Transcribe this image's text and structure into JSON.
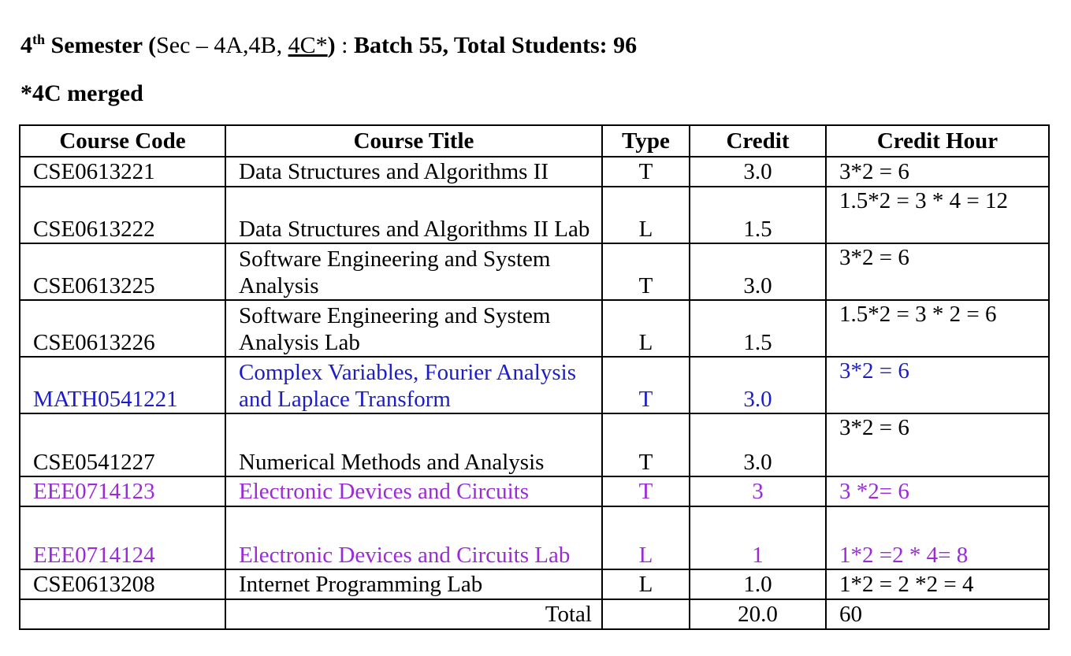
{
  "header": {
    "sem_num": "4",
    "sem_sup": "th",
    "sem_word": " Semester (",
    "sec_text": "Sec – 4A,4B, ",
    "sec_merged": "4C*",
    "close_paren": ")",
    "sep": " : ",
    "batch_text": "Batch 55, Total Students: 96",
    "note": "*4C merged"
  },
  "table": {
    "headers": [
      "Course Code",
      "Course Title",
      "Type",
      "Credit",
      "Credit Hour"
    ],
    "rows": [
      {
        "code": "CSE0613221",
        "title": "Data Structures and Algorithms II",
        "type": "T",
        "credit": "3.0",
        "hour": "3*2 = 6"
      },
      {
        "code": "CSE0613222",
        "title": "Data Structures and Algorithms II Lab",
        "type": "L",
        "credit": "1.5",
        "hour": "1.5*2 = 3 * 4 = 12"
      },
      {
        "code": "CSE0613225",
        "title": "Software Engineering and System Analysis",
        "type": "T",
        "credit": "3.0",
        "hour": "3*2 = 6"
      },
      {
        "code": "CSE0613226",
        "title": "Software Engineering and System Analysis Lab",
        "type": "L",
        "credit": "1.5",
        "hour": "1.5*2 = 3 * 2 = 6"
      },
      {
        "code": "MATH0541221",
        "title": "Complex Variables, Fourier Analysis and Laplace Transform",
        "type": "T",
        "credit": "3.0",
        "hour": "3*2 = 6"
      },
      {
        "code": "CSE0541227",
        "title": "Numerical Methods and Analysis",
        "type": "T",
        "credit": "3.0",
        "hour": "3*2 = 6"
      },
      {
        "code": "EEE0714123",
        "title": "Electronic Devices and Circuits",
        "type": "T",
        "credit": "3",
        "hour": "3 *2= 6"
      },
      {
        "code": "EEE0714124",
        "title": "Electronic Devices and Circuits Lab",
        "type": "L",
        "credit": "1",
        "hour": "1*2 =2 * 4= 8"
      },
      {
        "code": "CSE0613208",
        "title": "Internet Programming Lab",
        "type": "L",
        "credit": "1.0",
        "hour": "1*2 = 2 *2 = 4"
      }
    ],
    "total_label": "Total",
    "total_credit": "20.0",
    "total_hour": "60"
  },
  "colors": {
    "blue_row": "#1c1cc8",
    "purple_row": "#9b2bd6"
  }
}
